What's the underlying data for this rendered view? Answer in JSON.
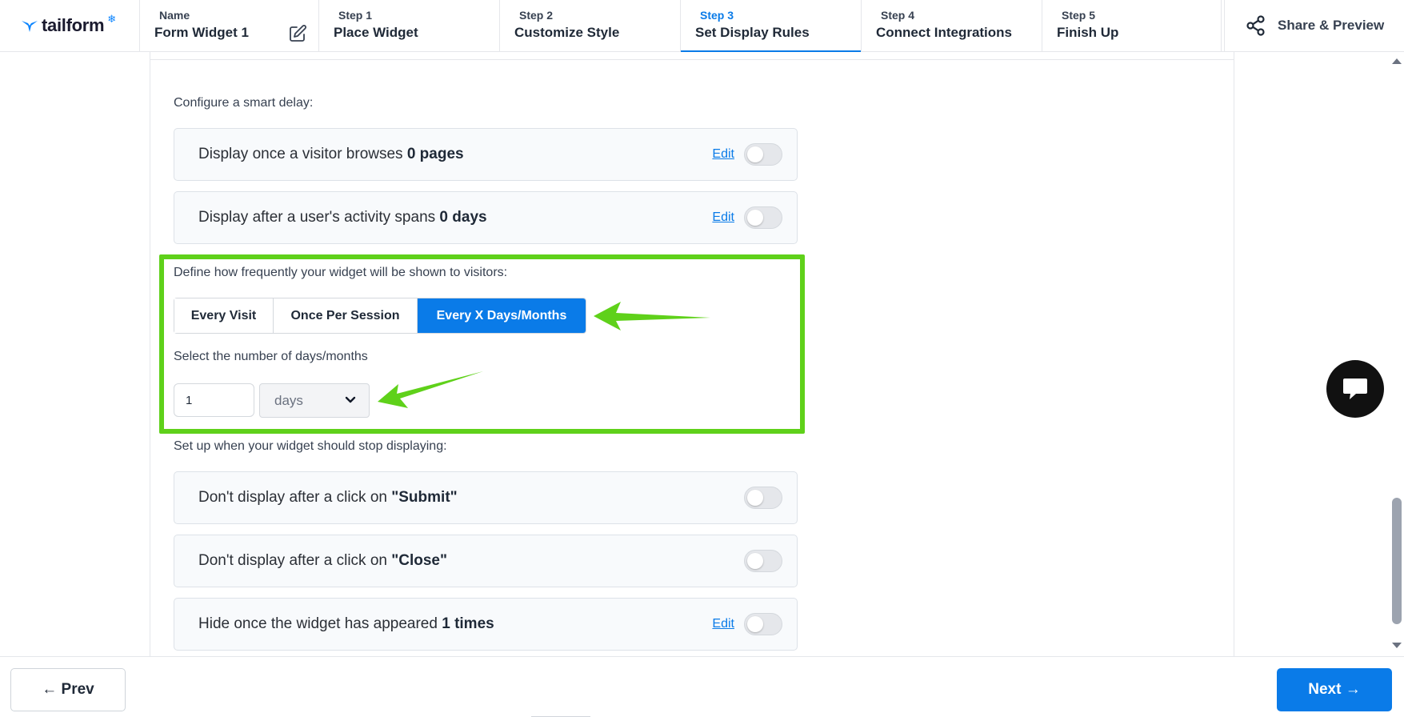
{
  "header": {
    "logo_text": "tailform",
    "name_label": "Name",
    "name_value": "Form Widget 1",
    "steps": [
      {
        "label": "Step 1",
        "title": "Place Widget"
      },
      {
        "label": "Step 2",
        "title": "Customize Style"
      },
      {
        "label": "Step 3",
        "title": "Set Display Rules"
      },
      {
        "label": "Step 4",
        "title": "Connect Integrations"
      },
      {
        "label": "Step 5",
        "title": "Finish Up"
      }
    ],
    "active_step": 3,
    "share_label": "Share & Preview"
  },
  "smart_delay": {
    "label": "Configure a smart delay:",
    "rules": [
      {
        "text": "Display once a visitor browses ",
        "value": "0 pages",
        "edit": "Edit",
        "enabled": false
      },
      {
        "text": "Display after a user's activity spans ",
        "value": "0 days",
        "edit": "Edit",
        "enabled": false
      }
    ]
  },
  "frequency": {
    "label": "Define how frequently your widget will be shown to visitors:",
    "options": [
      "Every Visit",
      "Once Per Session",
      "Every X Days/Months"
    ],
    "selected": "Every X Days/Months",
    "number_label": "Select the number of days/months",
    "number_value": "1",
    "unit_value": "days"
  },
  "stop_display": {
    "label": "Set up when your widget should stop displaying:",
    "rules": [
      {
        "text": "Don't display after a click on ",
        "value": "\"Submit\"",
        "enabled": false
      },
      {
        "text": "Don't display after a click on ",
        "value": "\"Close\"",
        "enabled": false
      },
      {
        "text": "Hide once the widget has appeared ",
        "value": "1 times",
        "edit": "Edit",
        "enabled": false
      }
    ]
  },
  "footer": {
    "prev_label": "← Prev",
    "next_label": "Next →"
  },
  "colors": {
    "accent": "#0a7be8",
    "highlight": "#5fd11a"
  }
}
